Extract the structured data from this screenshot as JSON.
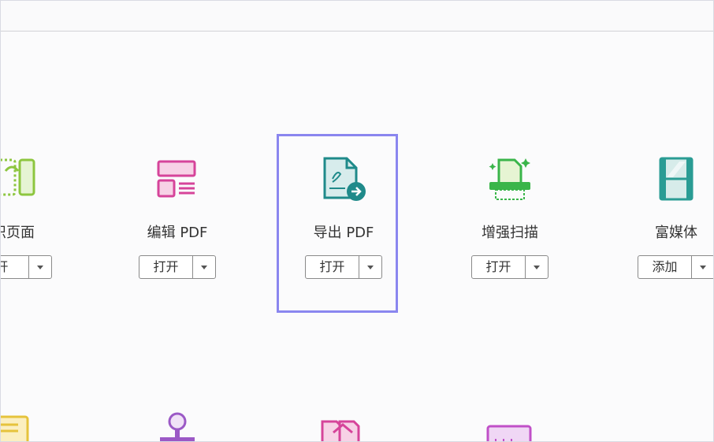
{
  "tools": [
    {
      "id": "organize",
      "label": "织页面",
      "button": "开",
      "icon": "organize-pages-icon"
    },
    {
      "id": "edit",
      "label": "编辑 PDF",
      "button": "打开",
      "icon": "edit-pdf-icon"
    },
    {
      "id": "export",
      "label": "导出 PDF",
      "button": "打开",
      "icon": "export-pdf-icon"
    },
    {
      "id": "enhance",
      "label": "增强扫描",
      "button": "打开",
      "icon": "enhance-scan-icon"
    },
    {
      "id": "rich",
      "label": "富媒体",
      "button": "添加",
      "icon": "rich-media-icon"
    }
  ],
  "colors": {
    "green": "#8dc63f",
    "pink": "#d6449a",
    "teal": "#1f8a8a",
    "scan_green": "#3ab54a",
    "film": "#2a9c94",
    "highlight": "#8a86ef",
    "yellow": "#e6c33c",
    "purple": "#9b59c6",
    "magenta": "#d6449a"
  }
}
